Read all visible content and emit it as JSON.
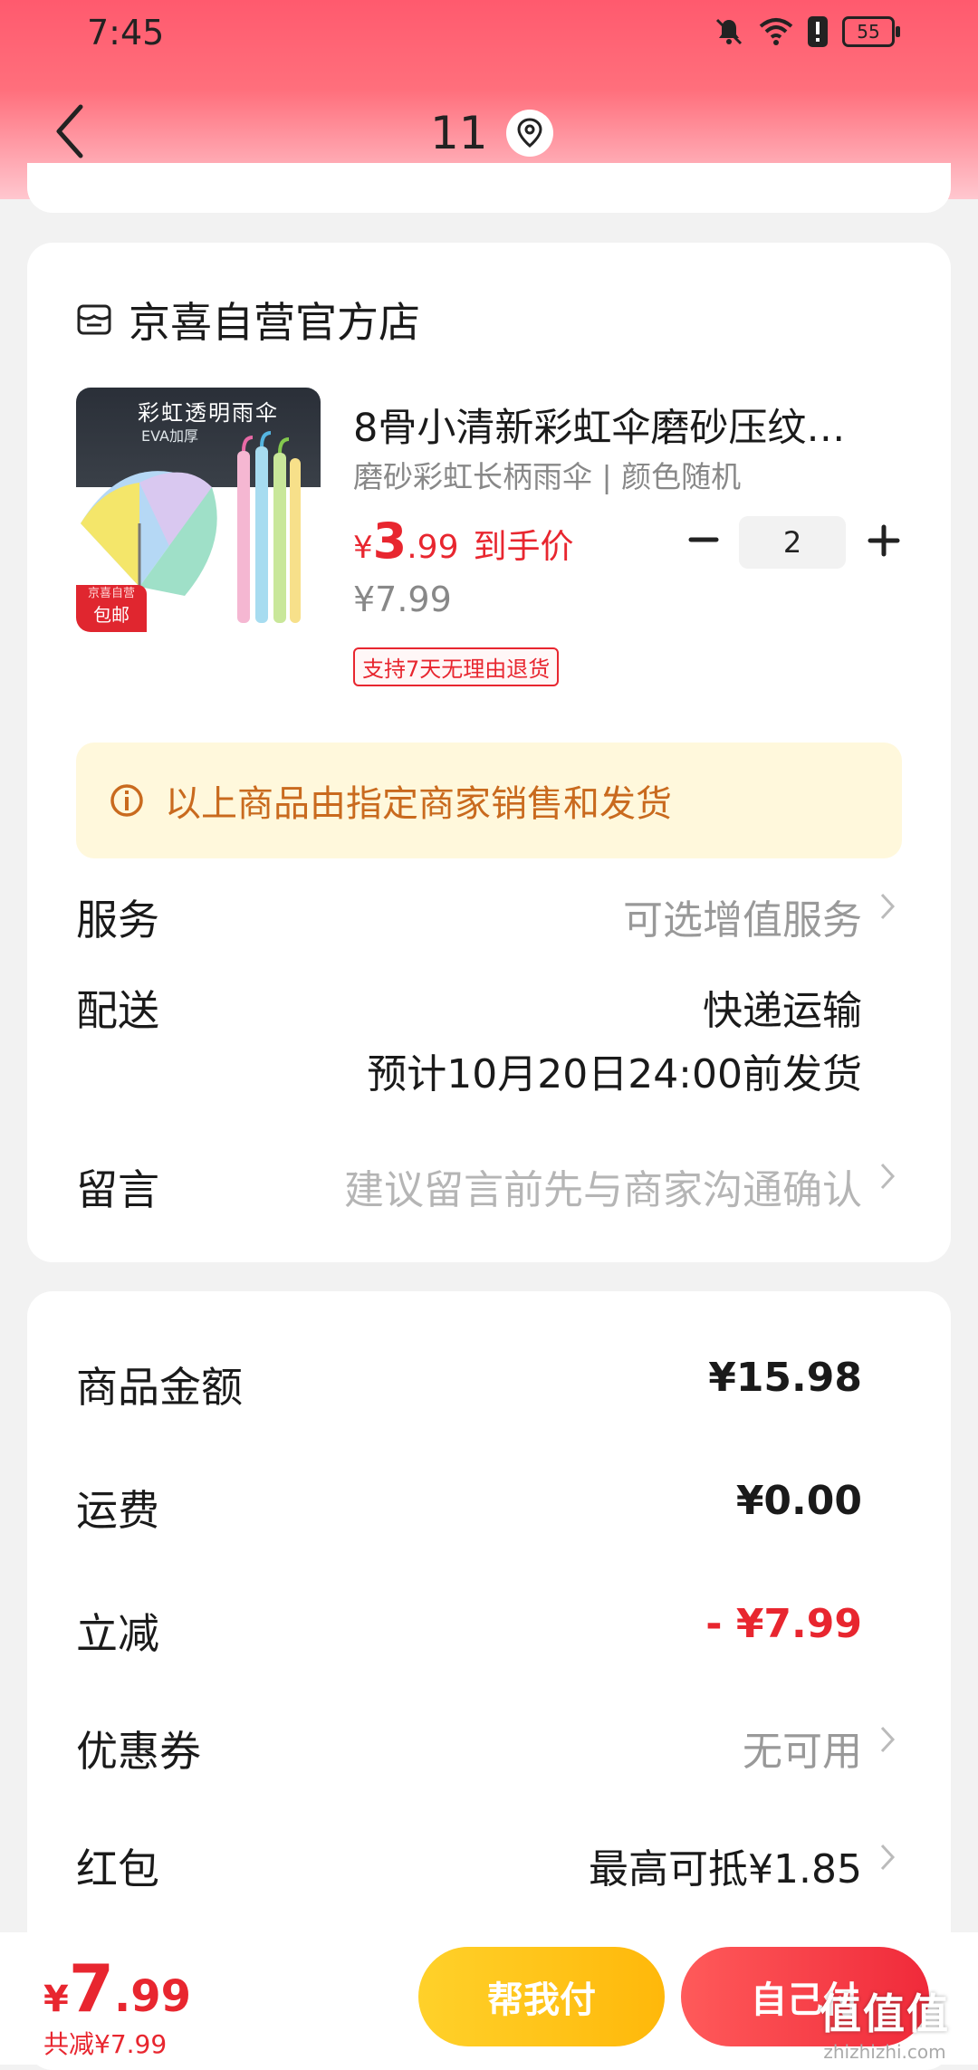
{
  "status_bar": {
    "time": "7:45",
    "battery": "55"
  },
  "header": {
    "location_text": "11"
  },
  "shop": {
    "name": "京喜自营官方店"
  },
  "product": {
    "image_title": "彩虹透明雨伞",
    "image_sub": "EVA加厚",
    "image_badge_top": "京喜自营",
    "image_badge_bottom": "包邮",
    "title": "8骨小清新彩虹伞磨砂压纹…",
    "spec": "磨砂彩虹长柄雨伞 | 颜色随机",
    "price_currency": "¥",
    "price_int": "3",
    "price_dec": ".99",
    "price_label": "到手价",
    "original_price": "¥7.99",
    "quantity": "2",
    "return_policy": "支持7天无理由退货"
  },
  "notice": {
    "text": "以上商品由指定商家销售和发货"
  },
  "service": {
    "label": "服务",
    "value": "可选增值服务"
  },
  "delivery": {
    "label": "配送",
    "method": "快递运输",
    "estimate": "预计10月20日24:00前发货"
  },
  "message": {
    "label": "留言",
    "placeholder": "建议留言前先与商家沟通确认"
  },
  "summary": {
    "goods_label": "商品金额",
    "goods_value": "¥15.98",
    "shipping_label": "运费",
    "shipping_value": "¥0.00",
    "discount_label": "立减",
    "discount_value": "- ¥7.99",
    "coupon_label": "优惠券",
    "coupon_value": "无可用",
    "redpacket_label": "红包",
    "redpacket_value": "最高可抵¥1.85"
  },
  "bottom": {
    "total_currency": "¥",
    "total_int": "7",
    "total_dec": ".99",
    "total_saved": "共减¥7.99",
    "help_pay": "帮我付",
    "self_pay": "自己付"
  },
  "watermark": {
    "big": "值值值",
    "small": "zhizhizhi.com"
  },
  "colors": {
    "accent_red": "#e8262f",
    "header_pink": "#ff5a6e",
    "notice_bg": "#fff8dc",
    "help_yellow": "#ffc21a"
  }
}
